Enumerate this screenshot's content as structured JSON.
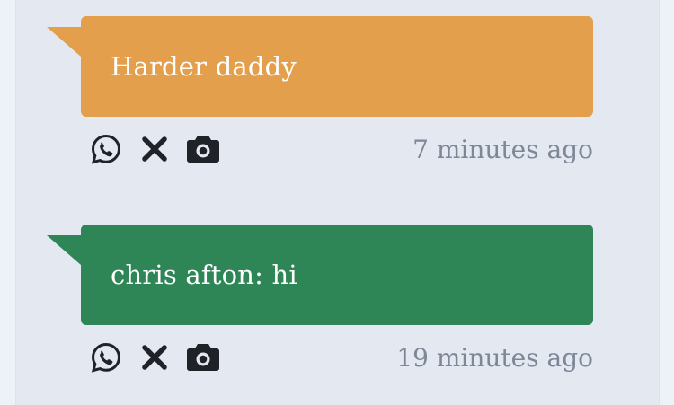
{
  "messages": [
    {
      "text": "Harder daddy",
      "color": "#e39f4c",
      "timestamp": "7 minutes ago",
      "actions": [
        "whatsapp-icon",
        "close-icon",
        "camera-icon"
      ]
    },
    {
      "text": "chris afton: hi",
      "color": "#2e8657",
      "timestamp": "19 minutes ago",
      "actions": [
        "whatsapp-icon",
        "close-icon",
        "camera-icon"
      ]
    }
  ],
  "colors": {
    "background": "#e3e8f1",
    "icon": "#1f2328",
    "timestamp": "#7d8797"
  }
}
